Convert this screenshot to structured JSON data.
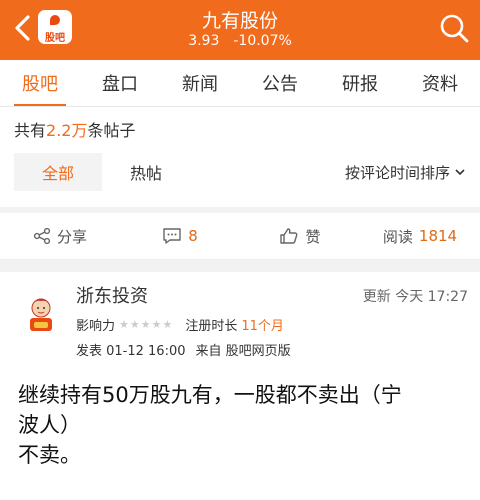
{
  "header": {
    "logo_text": "股吧",
    "stock_name": "九有股份",
    "price": "3.93",
    "change": "-10.07%",
    "colors": {
      "bar": "#f06b1c"
    }
  },
  "tabs": [
    "股吧",
    "盘口",
    "新闻",
    "公告",
    "研报",
    "资料"
  ],
  "summary": {
    "prefix": "共有",
    "count": "2.2万",
    "suffix": "条帖子"
  },
  "filters": {
    "all": "全部",
    "hot": "热帖",
    "sort": "按评论时间排序"
  },
  "actions": {
    "share": "分享",
    "comment_count": "8",
    "like": "赞",
    "read_label": "阅读",
    "read_count": "1814"
  },
  "post": {
    "author": "浙东投资",
    "updated_label": "更新",
    "updated_time": "今天 17:27",
    "influence_label": "影响力",
    "stars": "★★★★★",
    "reg_label": "注册时长",
    "reg_value": "11个月",
    "posted": "发表 01-12 16:00",
    "source": "来自 股吧网页版",
    "title_lines": [
      "继续持有50万股九有，一股都不卖出（宁",
      "波人）"
    ],
    "body": "不卖。"
  }
}
